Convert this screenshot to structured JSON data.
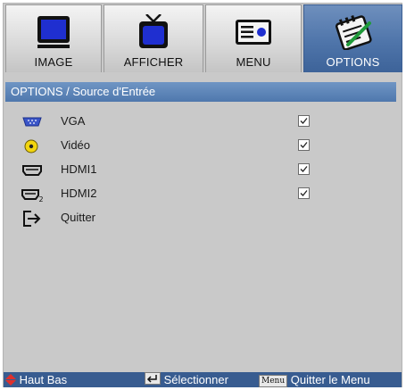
{
  "tabs": [
    {
      "label": "IMAGE",
      "icon": "monitor-icon",
      "active": false
    },
    {
      "label": "AFFICHER",
      "icon": "tv-icon",
      "active": false
    },
    {
      "label": "MENU",
      "icon": "menu-icon",
      "active": false
    },
    {
      "label": "OPTIONS",
      "icon": "notepad-icon",
      "active": true
    }
  ],
  "breadcrumb": "OPTIONS / Source d'Entrée",
  "items": [
    {
      "label": "VGA",
      "icon": "vga-icon",
      "checked": true
    },
    {
      "label": "Vidéo",
      "icon": "video-icon",
      "checked": true
    },
    {
      "label": "HDMI1",
      "icon": "hdmi-icon",
      "checked": true
    },
    {
      "label": "HDMI2",
      "icon": "hdmi2-icon",
      "checked": true
    },
    {
      "label": "Quitter",
      "icon": "exit-icon",
      "checked": null
    }
  ],
  "status": {
    "nav": "Haut Bas",
    "select": "Sélectionner",
    "menu_key": "Menu",
    "exit": "Quitter le Menu"
  },
  "colors": {
    "accent": "#4f78ad",
    "statusbar": "#385c90",
    "panel": "#c9c9c9",
    "nav_arrow": "#e0302c"
  }
}
